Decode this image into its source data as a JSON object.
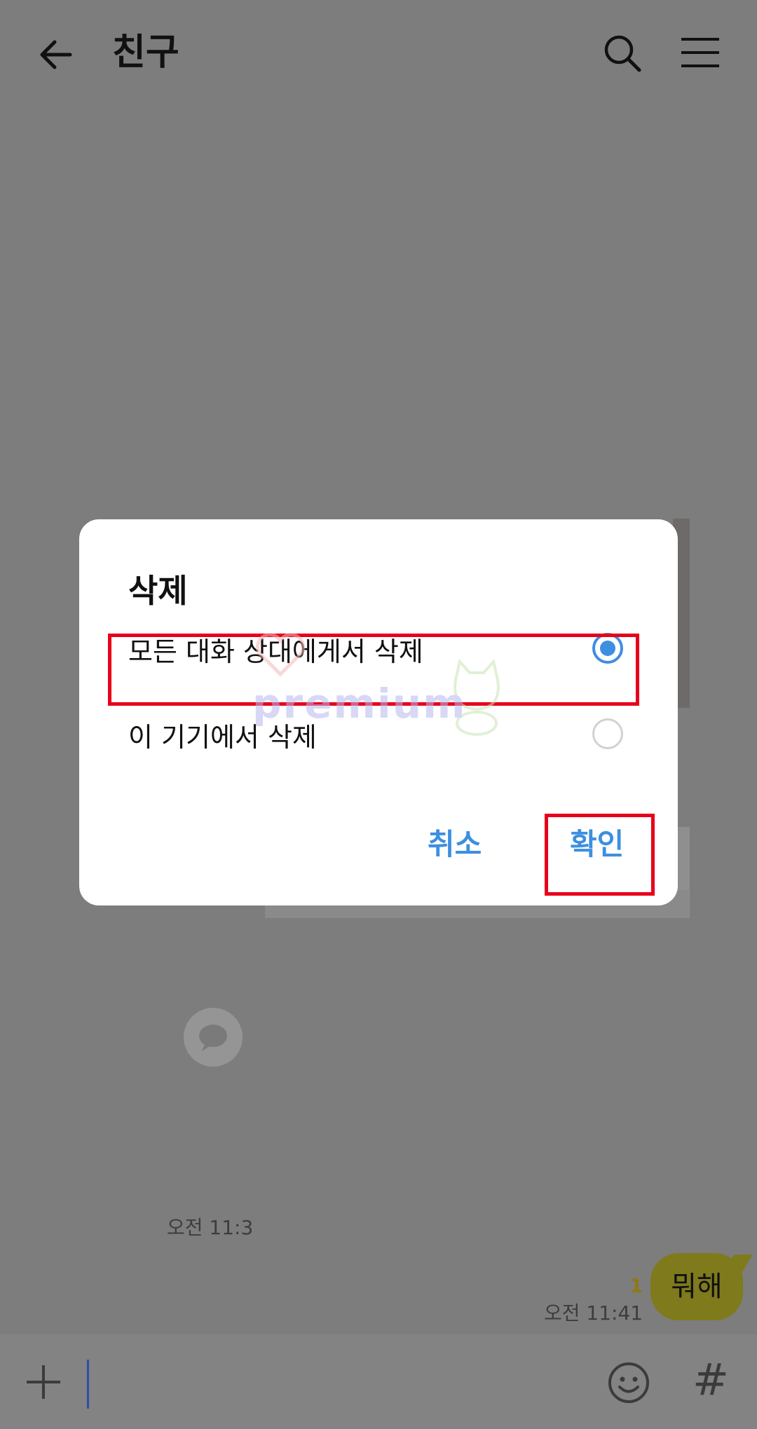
{
  "header": {
    "title": "친구",
    "icons": [
      "back-icon",
      "search-icon",
      "menu-icon"
    ]
  },
  "chat": {
    "left_time": "오전 11:3",
    "unread_count": "1",
    "my_message": "뭐해",
    "my_time": "오전 11:41"
  },
  "input": {
    "icons": [
      "plus-icon",
      "emoji-icon",
      "hash-icon"
    ],
    "hash_symbol": "#"
  },
  "dialog": {
    "title": "삭제",
    "options": [
      {
        "label": "모든 대화 상대에게서 삭제",
        "selected": true
      },
      {
        "label": "이 기기에서 삭제",
        "selected": false
      }
    ],
    "cancel_label": "취소",
    "confirm_label": "확인"
  },
  "watermark": {
    "text": "premium"
  },
  "colors": {
    "accent": "#3d8fe0",
    "highlight": "#e8001b",
    "bubble": "#f7e600",
    "dim_overlay": "#7d7d7d"
  }
}
